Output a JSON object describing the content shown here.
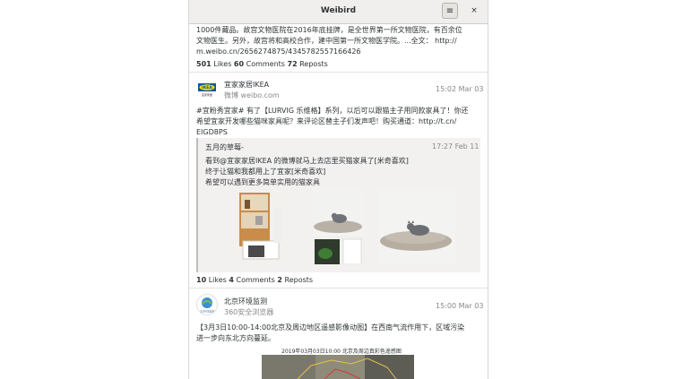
{
  "window": {
    "title": "Weibird",
    "menu_icon": "hamburger-menu-icon",
    "close_icon": "close-icon",
    "menu_glyph": "≡",
    "close_glyph": "×"
  },
  "post1": {
    "lines": [
      "1000件藏品。故宫文物医院在2016年底挂牌，是全世界第一所文物医院，有百余位",
      "文物医生。另外，故宫将和高校合作，建中国第一所文物医学院。...全文： http://",
      "m.weibo.cn/2656274875/4345782557166426"
    ],
    "likes": "501",
    "likes_label": "Likes",
    "comments": "60",
    "comments_label": "Comments",
    "reposts": "72",
    "reposts_label": "Reposts"
  },
  "post2": {
    "author": "宜家家居IKEA",
    "source": "微博 weibo.com",
    "time": "15:02 Mar 03",
    "avatar_text": "IKEA",
    "avatar_caption": "宜家家居",
    "lines": [
      "#宜粉秀宜家# 有了【LURVIG 乐维格】系列，以后可以跟猫主子用同款家具了！你还",
      "希望宜家开发哪些猫咪家具呢？来评论区替主子们发声吧！购买通道：http://t.cn/",
      "EIGD8PS"
    ],
    "quote": {
      "author": "五月的草莓-",
      "time": "17:27 Feb 11",
      "lines": [
        "看到@宜家家居IKEA 的微博就马上去店里买猫家具了[米奇喜欢]",
        "终于让猫和我都用上了宜家[米奇喜欢]",
        "希望可以遇到更多简单实用的猫家具"
      ]
    },
    "likes": "10",
    "likes_label": "Likes",
    "comments": "4",
    "comments_label": "Comments",
    "reposts": "2",
    "reposts_label": "Reposts"
  },
  "post3": {
    "author": "北京环境监测",
    "source": "360安全浏览器",
    "time": "15:00 Mar 03",
    "avatar_caption": "北京环境监测",
    "lines": [
      "【3月3日10:00-14:00北京及周边地区遥感影像动图】在西南气流作用下，区域污染",
      "进一步向东北方向蔓延。"
    ],
    "image_caption": "2019年03月03日10:00 北京及周边真彩色遥感图"
  },
  "colors": {
    "ikea_blue": "#0058a3",
    "ikea_yellow": "#ffdb00",
    "accent_red": "#d8382d"
  }
}
